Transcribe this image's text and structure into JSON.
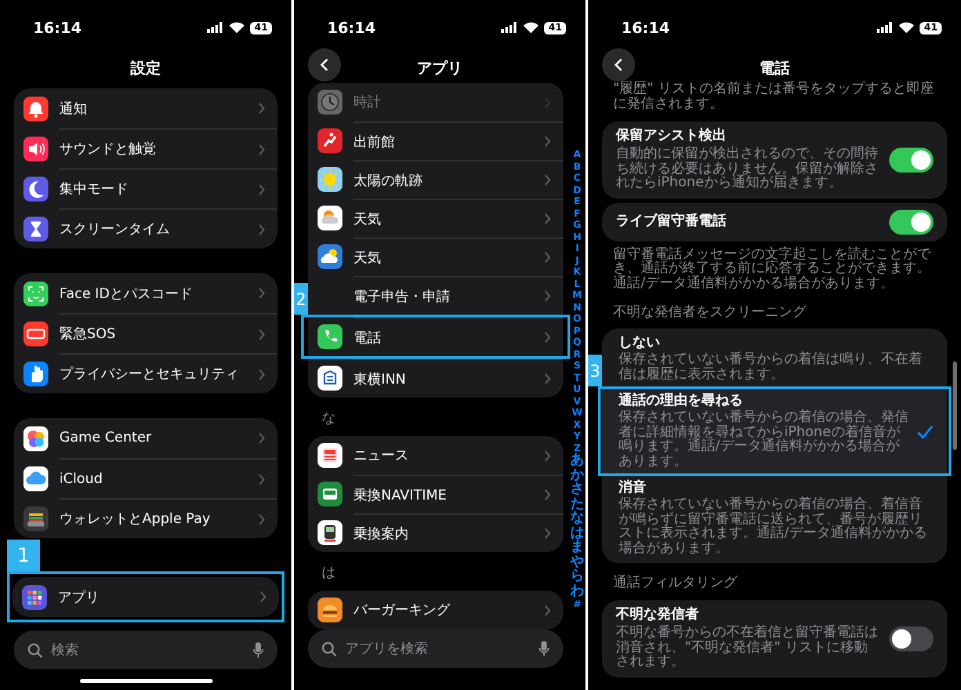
{
  "settings": {
    "status": {
      "time": "16:14",
      "battery": "41"
    },
    "title": "設定",
    "groups": [
      {
        "highlighted": false,
        "items": [
          {
            "label": "通知"
          },
          {
            "label": "サウンドと触覚"
          },
          {
            "label": "集中モード"
          },
          {
            "label": "スクリーンタイム"
          }
        ]
      },
      {
        "highlighted": false,
        "items": [
          {
            "label": "Face IDとパスコード"
          },
          {
            "label": "緊急SOS"
          },
          {
            "label": "プライバシーとセキュリティ"
          }
        ]
      },
      {
        "highlighted": false,
        "items": [
          {
            "label": "Game Center"
          },
          {
            "label": "iCloud"
          },
          {
            "label": "ウォレットとApple Pay"
          }
        ]
      },
      {
        "highlighted": true,
        "step": "1",
        "items": [
          {
            "label": "アプリ"
          }
        ]
      }
    ],
    "search": {
      "placeholder": "検索"
    }
  },
  "apps": {
    "status": {
      "time": "16:14",
      "battery": "41"
    },
    "title": "アプリ",
    "sections": [
      {
        "rows": [
          {
            "label": "時計",
            "dimmed": true,
            "highlighted": false
          },
          {
            "label": "出前館",
            "dimmed": false,
            "highlighted": false
          },
          {
            "label": "太陽の軌跡",
            "dimmed": false,
            "highlighted": false
          },
          {
            "label": "天気",
            "dimmed": false,
            "highlighted": false
          },
          {
            "label": "天気",
            "dimmed": false,
            "highlighted": false
          },
          {
            "label": "電子申告・申請",
            "dimmed": false,
            "highlighted": false
          },
          {
            "label": "電話",
            "dimmed": false,
            "highlighted": true,
            "step": "2"
          },
          {
            "label": "東横INN",
            "dimmed": false,
            "highlighted": false
          }
        ]
      },
      {
        "header": "な",
        "rows": [
          {
            "label": "ニュース",
            "dimmed": false,
            "highlighted": false
          },
          {
            "label": "乗換NAVITIME",
            "dimmed": false,
            "highlighted": false
          },
          {
            "label": "乗換案内",
            "dimmed": false,
            "highlighted": false
          }
        ]
      },
      {
        "header": "は",
        "rows": [
          {
            "label": "バーガーキング",
            "dimmed": false,
            "highlighted": false
          }
        ]
      }
    ],
    "index": [
      "A",
      "B",
      "C",
      "D",
      "E",
      "F",
      "G",
      "H",
      "I",
      "J",
      "K",
      "L",
      "M",
      "N",
      "O",
      "P",
      "Q",
      "R",
      "S",
      "T",
      "U",
      "V",
      "W",
      "X",
      "Y",
      "Z",
      "あ",
      "か",
      "さ",
      "た",
      "な",
      "は",
      "ま",
      "や",
      "ら",
      "わ",
      "#"
    ],
    "search": {
      "placeholder": "アプリを検索"
    }
  },
  "phone": {
    "status": {
      "time": "16:14",
      "battery": "41"
    },
    "title": "電話",
    "blocks": [
      {
        "kind": "footnote",
        "text": "\"履歴\" リストの名前または番号をタップすると即座に発信されます。"
      },
      {
        "kind": "toggle",
        "title": "保留アシスト検出",
        "text": "自動的に保留が検出されるので、その間待ち続ける必要はありません。保留が解除されたらiPhoneから通知が届きます。",
        "on": true
      },
      {
        "kind": "toggle",
        "title": "ライブ留守番電話",
        "on": true
      },
      {
        "kind": "footnote",
        "text": "留守番電話メッセージの文字起こしを読むことができ、通話が終了する前に応答することができます。通話/データ通信料がかかる場合があります。"
      },
      {
        "kind": "header",
        "text": "不明な発信者をスクリーニング"
      },
      {
        "kind": "options",
        "options": [
          {
            "title": "しない",
            "text": "保存されていない番号からの着信は鳴り、不在着信は履歴に表示されます。",
            "selected": false,
            "highlighted": false
          },
          {
            "title": "通話の理由を尋ねる",
            "text": "保存されていない番号からの着信の場合、発信者に詳細情報を尋ねてからiPhoneの着信音が鳴ります。通話/データ通信料がかかる場合があります。",
            "selected": true,
            "highlighted": true,
            "step": "3"
          },
          {
            "title": "消音",
            "text": "保存されていない番号からの着信の場合、着信音が鳴らずに留守番電話に送られて、番号が履歴リストに表示されます。通話/データ通信料がかかる場合があります。",
            "selected": false,
            "highlighted": false
          }
        ]
      },
      {
        "kind": "header",
        "text": "通話フィルタリング"
      },
      {
        "kind": "toggle",
        "title": "不明な発信者",
        "text": "不明な番号からの不在着信と留守番電話は消音され、\"不明な発信者\" リストに移動されます。",
        "on": false
      }
    ]
  }
}
